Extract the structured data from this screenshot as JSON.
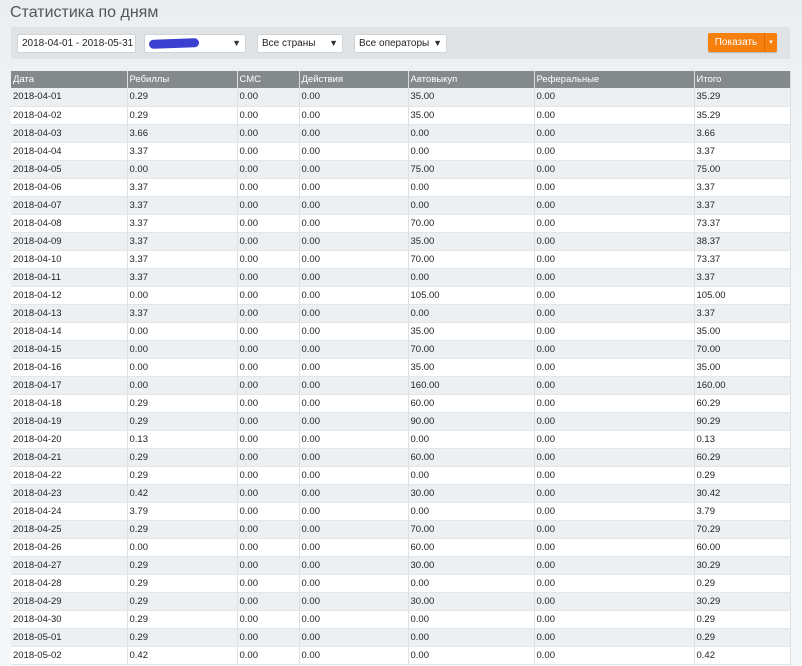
{
  "page_title": "Статистика по дням",
  "filters": {
    "date_range": "2018-04-01 - 2018-05-31",
    "countries": "Все страны",
    "operators": "Все операторы",
    "show_button": "Показать",
    "arrow": "▼",
    "caret": "▾"
  },
  "colors": {
    "accent": "#f77f0e",
    "header_bg": "#848a8c",
    "redaction": "#3c40d0"
  },
  "table": {
    "columns": [
      "Дата",
      "Ребиллы",
      "СМС",
      "Действия",
      "Автовыкуп",
      "Реферальные",
      "Итого"
    ],
    "rows": [
      [
        "2018-04-01",
        "0.29",
        "0.00",
        "0.00",
        "35.00",
        "0.00",
        "35.29"
      ],
      [
        "2018-04-02",
        "0.29",
        "0.00",
        "0.00",
        "35.00",
        "0.00",
        "35.29"
      ],
      [
        "2018-04-03",
        "3.66",
        "0.00",
        "0.00",
        "0.00",
        "0.00",
        "3.66"
      ],
      [
        "2018-04-04",
        "3.37",
        "0.00",
        "0.00",
        "0.00",
        "0.00",
        "3.37"
      ],
      [
        "2018-04-05",
        "0.00",
        "0.00",
        "0.00",
        "75.00",
        "0.00",
        "75.00"
      ],
      [
        "2018-04-06",
        "3.37",
        "0.00",
        "0.00",
        "0.00",
        "0.00",
        "3.37"
      ],
      [
        "2018-04-07",
        "3.37",
        "0.00",
        "0.00",
        "0.00",
        "0.00",
        "3.37"
      ],
      [
        "2018-04-08",
        "3.37",
        "0.00",
        "0.00",
        "70.00",
        "0.00",
        "73.37"
      ],
      [
        "2018-04-09",
        "3.37",
        "0.00",
        "0.00",
        "35.00",
        "0.00",
        "38.37"
      ],
      [
        "2018-04-10",
        "3.37",
        "0.00",
        "0.00",
        "70.00",
        "0.00",
        "73.37"
      ],
      [
        "2018-04-11",
        "3.37",
        "0.00",
        "0.00",
        "0.00",
        "0.00",
        "3.37"
      ],
      [
        "2018-04-12",
        "0.00",
        "0.00",
        "0.00",
        "105.00",
        "0.00",
        "105.00"
      ],
      [
        "2018-04-13",
        "3.37",
        "0.00",
        "0.00",
        "0.00",
        "0.00",
        "3.37"
      ],
      [
        "2018-04-14",
        "0.00",
        "0.00",
        "0.00",
        "35.00",
        "0.00",
        "35.00"
      ],
      [
        "2018-04-15",
        "0.00",
        "0.00",
        "0.00",
        "70.00",
        "0.00",
        "70.00"
      ],
      [
        "2018-04-16",
        "0.00",
        "0.00",
        "0.00",
        "35.00",
        "0.00",
        "35.00"
      ],
      [
        "2018-04-17",
        "0.00",
        "0.00",
        "0.00",
        "160.00",
        "0.00",
        "160.00"
      ],
      [
        "2018-04-18",
        "0.29",
        "0.00",
        "0.00",
        "60.00",
        "0.00",
        "60.29"
      ],
      [
        "2018-04-19",
        "0.29",
        "0.00",
        "0.00",
        "90.00",
        "0.00",
        "90.29"
      ],
      [
        "2018-04-20",
        "0.13",
        "0.00",
        "0.00",
        "0.00",
        "0.00",
        "0.13"
      ],
      [
        "2018-04-21",
        "0.29",
        "0.00",
        "0.00",
        "60.00",
        "0.00",
        "60.29"
      ],
      [
        "2018-04-22",
        "0.29",
        "0.00",
        "0.00",
        "0.00",
        "0.00",
        "0.29"
      ],
      [
        "2018-04-23",
        "0.42",
        "0.00",
        "0.00",
        "30.00",
        "0.00",
        "30.42"
      ],
      [
        "2018-04-24",
        "3.79",
        "0.00",
        "0.00",
        "0.00",
        "0.00",
        "3.79"
      ],
      [
        "2018-04-25",
        "0.29",
        "0.00",
        "0.00",
        "70.00",
        "0.00",
        "70.29"
      ],
      [
        "2018-04-26",
        "0.00",
        "0.00",
        "0.00",
        "60.00",
        "0.00",
        "60.00"
      ],
      [
        "2018-04-27",
        "0.29",
        "0.00",
        "0.00",
        "30.00",
        "0.00",
        "30.29"
      ],
      [
        "2018-04-28",
        "0.29",
        "0.00",
        "0.00",
        "0.00",
        "0.00",
        "0.29"
      ],
      [
        "2018-04-29",
        "0.29",
        "0.00",
        "0.00",
        "30.00",
        "0.00",
        "30.29"
      ],
      [
        "2018-04-30",
        "0.29",
        "0.00",
        "0.00",
        "0.00",
        "0.00",
        "0.29"
      ],
      [
        "2018-05-01",
        "0.29",
        "0.00",
        "0.00",
        "0.00",
        "0.00",
        "0.29"
      ],
      [
        "2018-05-02",
        "0.42",
        "0.00",
        "0.00",
        "0.00",
        "0.00",
        "0.42"
      ]
    ]
  }
}
